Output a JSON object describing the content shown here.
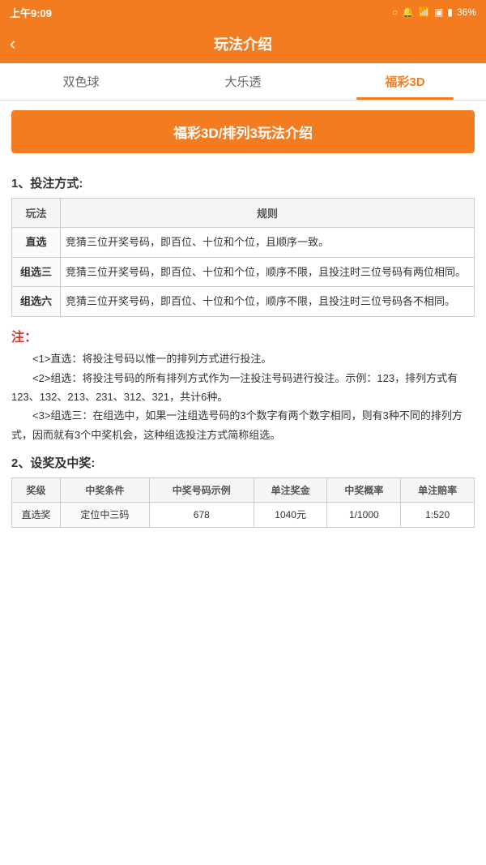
{
  "statusBar": {
    "time": "上午9:09",
    "battery": "36%"
  },
  "topNav": {
    "title": "玩法介绍",
    "backLabel": "‹"
  },
  "tabs": [
    {
      "id": "shuangseqiu",
      "label": "双色球",
      "active": false
    },
    {
      "id": "daletou",
      "label": "大乐透",
      "active": false
    },
    {
      "id": "fucai3d",
      "label": "福彩3D",
      "active": true
    }
  ],
  "banner": {
    "text": "福彩3D/排列3玩法介绍"
  },
  "section1": {
    "title": "1、投注方式:",
    "tableHeaders": [
      "玩法",
      "规则"
    ],
    "tableRows": [
      {
        "name": "直选",
        "rule": "竞猜三位开奖号码，即百位、十位和个位，且顺序一致。"
      },
      {
        "name": "组选三",
        "rule": "竞猜三位开奖号码，即百位、十位和个位，顺序不限，且投注时三位号码有两位相同。"
      },
      {
        "name": "组选六",
        "rule": "竞猜三位开奖号码，即百位、十位和个位，顺序不限，且投注时三位号码各不相同。"
      }
    ]
  },
  "noteSection": {
    "title": "注：",
    "notes": [
      "<1>直选：将投注号码以惟一的排列方式进行投注。",
      "<2>组选：将投注号码的所有排列方式作为一注投注号码进行投注。示例：123，排列方式有123、132、213、231、312、321，共计6种。",
      "<3>组选三：在组选中，如果一注组选号码的3个数字有两个数字相同，则有3种不同的排列方式，因而就有3个中奖机会，这种组选投注方式简称组选。"
    ]
  },
  "section2": {
    "title": "2、设奖及中奖:",
    "tableHeaders": [
      "奖级",
      "中奖条件",
      "中奖号码示例",
      "单注奖金",
      "中奖概率",
      "单注赔率"
    ],
    "tableRows": [
      {
        "level": "直选奖",
        "condition": "定位中三码",
        "example": "678",
        "prize": "1040元",
        "rate": "1/1000",
        "ratio": "1:520"
      }
    ]
  }
}
